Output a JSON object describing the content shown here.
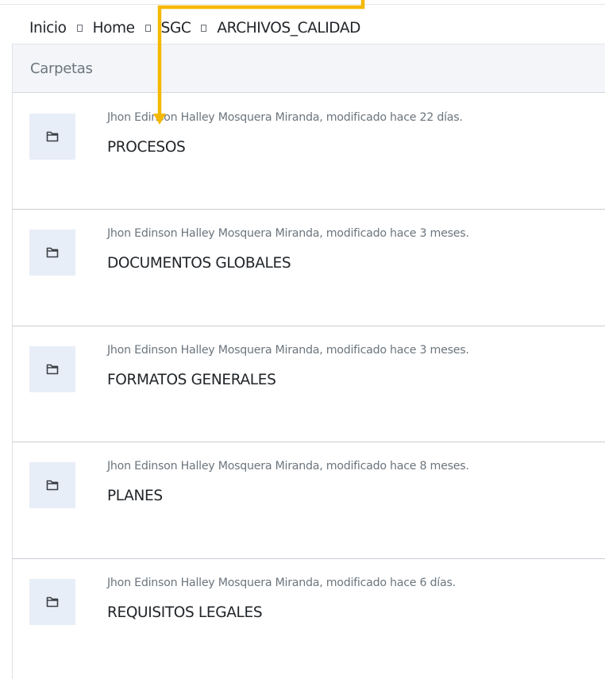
{
  "breadcrumb": {
    "items": [
      "Inicio",
      "Home",
      "SGC",
      "ARCHIVOS_CALIDAD"
    ]
  },
  "folders_panel": {
    "header": "Carpetas",
    "items": [
      {
        "meta": "Jhon Edinson Halley Mosquera Miranda, modificado hace 22 días.",
        "name": "PROCESOS"
      },
      {
        "meta": "Jhon Edinson Halley Mosquera Miranda, modificado hace 3 meses.",
        "name": "DOCUMENTOS GLOBALES"
      },
      {
        "meta": "Jhon Edinson Halley Mosquera Miranda, modificado hace 3 meses.",
        "name": "FORMATOS GENERALES"
      },
      {
        "meta": "Jhon Edinson Halley Mosquera Miranda, modificado hace 8 meses.",
        "name": "PLANES"
      },
      {
        "meta": "Jhon Edinson Halley Mosquera Miranda, modificado hace 6 días.",
        "name": "REQUISITOS LEGALES"
      }
    ]
  },
  "icons": {
    "folder": "folder-icon",
    "separator": "chevron-separator-icon"
  },
  "colors": {
    "annotation_arrow": "#f5b800",
    "icon_bg": "#e8eef7",
    "header_bg": "#f3f5f8"
  }
}
